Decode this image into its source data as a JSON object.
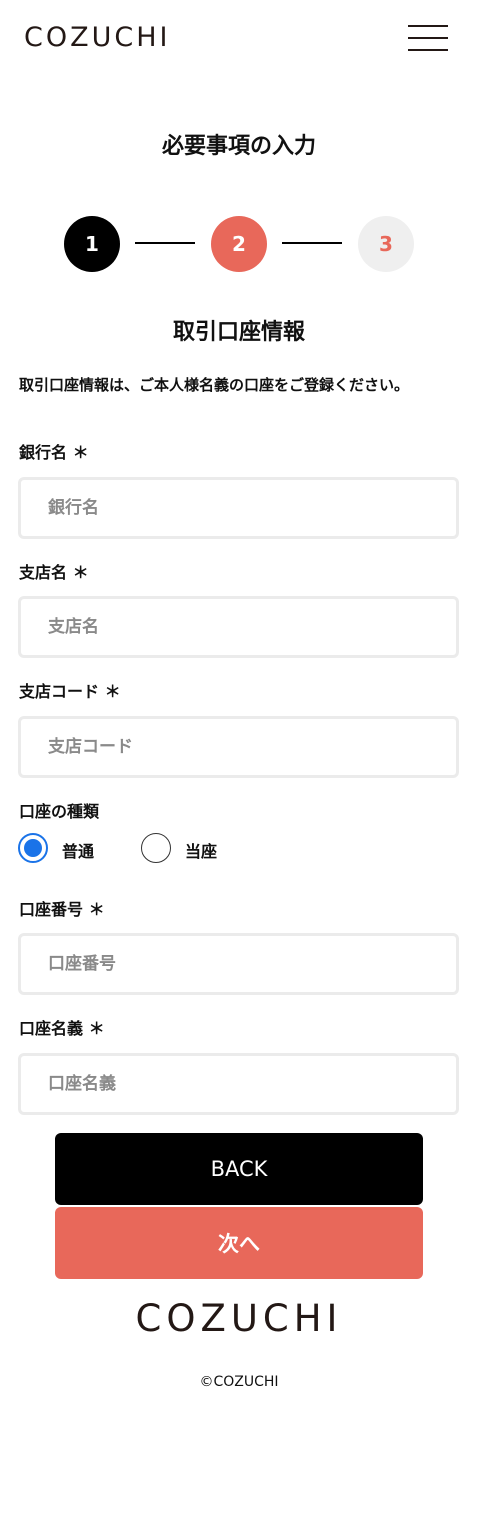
{
  "header": {
    "logo": "COZUCHI",
    "menu_icon": "hamburger-menu-icon"
  },
  "page_title": "必要事項の入力",
  "steps": {
    "step1": "1",
    "step2": "2",
    "step3": "3",
    "current": 2
  },
  "section_title": "取引口座情報",
  "note": "取引口座情報は、ご本人様名義の口座をご登録ください。",
  "fields": {
    "bank_name": {
      "label": "銀行名 ＊",
      "placeholder": "銀行名",
      "value": ""
    },
    "branch_name": {
      "label": "支店名 ＊",
      "placeholder": "支店名",
      "value": ""
    },
    "branch_code": {
      "label": "支店コード ＊",
      "placeholder": "支店コード",
      "value": ""
    },
    "account_type": {
      "label": "口座の種類",
      "options": [
        "普通",
        "当座"
      ],
      "selected": "普通"
    },
    "account_number": {
      "label": "口座番号 ＊",
      "placeholder": "口座番号",
      "value": ""
    },
    "account_holder": {
      "label": "口座名義 ＊",
      "placeholder": "口座名義",
      "value": ""
    }
  },
  "buttons": {
    "back": "BACK",
    "next": "次へ"
  },
  "footer": {
    "logo": "COZUCHI",
    "copyright": "©COZUCHI"
  },
  "colors": {
    "accent": "#e8685a",
    "primary": "#000000",
    "radio_selected": "#1a73e8",
    "step_inactive_bg": "#efefef"
  }
}
